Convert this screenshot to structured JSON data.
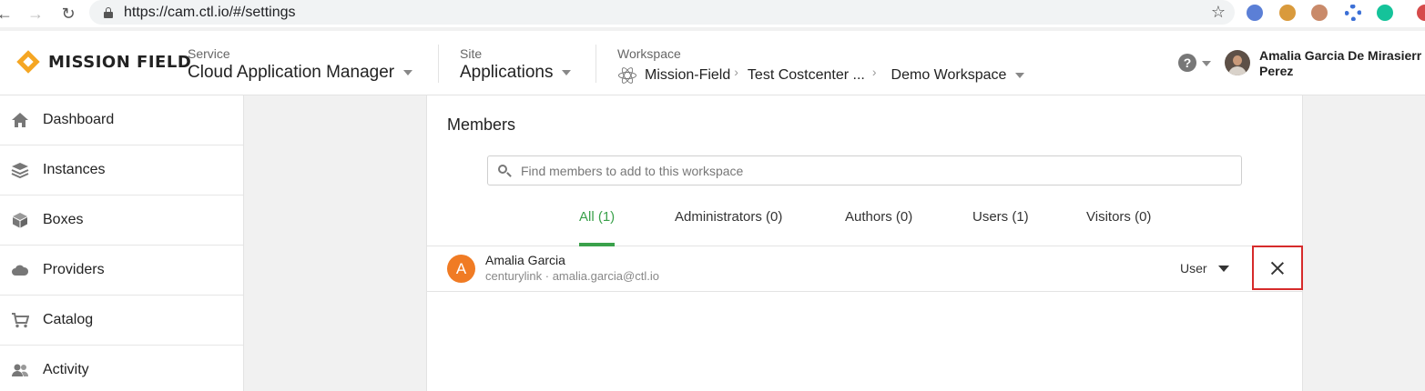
{
  "browser": {
    "url": "https://cam.ctl.io/#/settings",
    "back_icon": "arrow-left-icon",
    "forward_icon": "arrow-right-icon",
    "reload_icon": "reload-icon",
    "bookmark_icon": "star-icon"
  },
  "header": {
    "logo_text": "MISSION FIELD",
    "service": {
      "label": "Service",
      "value": "Cloud Application Manager"
    },
    "site": {
      "label": "Site",
      "value": "Applications"
    },
    "workspace": {
      "label": "Workspace",
      "crumbs": [
        "Mission-Field",
        "Test Costcenter ...",
        "Demo Workspace"
      ]
    },
    "help_icon": "?",
    "user": {
      "first_line": "Amalia Garcia De Mirasierr",
      "second_line": "Perez"
    }
  },
  "sidebar": {
    "items": [
      {
        "label": "Dashboard",
        "icon": "home-icon"
      },
      {
        "label": "Instances",
        "icon": "layers-icon"
      },
      {
        "label": "Boxes",
        "icon": "box-icon"
      },
      {
        "label": "Providers",
        "icon": "cloud-icon"
      },
      {
        "label": "Catalog",
        "icon": "cart-icon"
      },
      {
        "label": "Activity",
        "icon": "users-icon"
      }
    ]
  },
  "members": {
    "title": "Members",
    "search_placeholder": "Find members to add to this workspace",
    "tabs": [
      {
        "label": "All (1)",
        "active": true
      },
      {
        "label": "Administrators (0)",
        "active": false
      },
      {
        "label": "Authors (0)",
        "active": false
      },
      {
        "label": "Users (1)",
        "active": false
      },
      {
        "label": "Visitors (0)",
        "active": false
      }
    ],
    "rows": [
      {
        "initial": "A",
        "name": "Amalia Garcia",
        "subtitle": "centurylink · amalia.garcia@ctl.io",
        "role": "User"
      }
    ]
  },
  "colors": {
    "accent_green": "#3aa14b",
    "avatar_orange": "#f07b24",
    "logo_gold": "#f5a623",
    "highlight_red": "#d62b2b"
  }
}
